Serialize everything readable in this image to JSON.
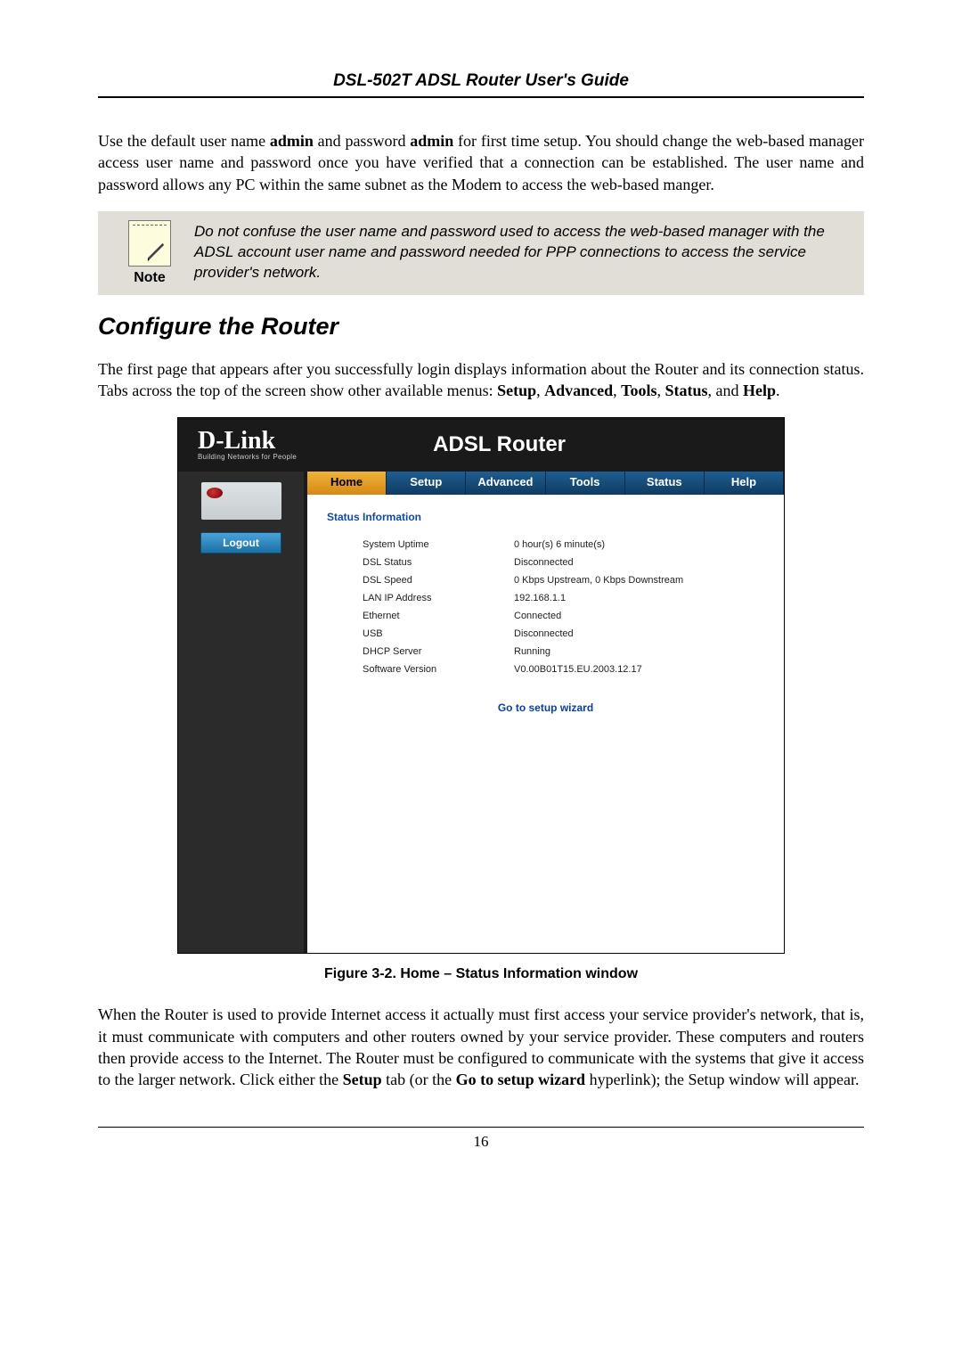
{
  "header": {
    "title": "DSL-502T ADSL Router User's Guide"
  },
  "intro_html": "Use the default user name <b>admin</b> and password <b>admin</b> for first time setup. You should change the web-based manager access user name and password once you have verified that a connection can be established. The user name and password allows any PC within the same subnet as the Modem to access the web-based manger.",
  "note": {
    "label": "Note",
    "text": "Do not confuse the user name and password used to access the web-based manager with the ADSL account user name and password needed for PPP connections to access the service provider's network."
  },
  "section_title": "Configure the Router",
  "section_intro_html": "The first page that appears after you successfully login displays information about the Router and its connection status. Tabs across the top of the screen show other available menus: <b>Setup</b>, <b>Advanced</b>, <b>Tools</b>, <b>Status</b>, and <b>Help</b>.",
  "figure": {
    "logo": "D-Link",
    "logo_sub": "Building Networks for People",
    "product": "ADSL Router",
    "logout": "Logout",
    "tabs": [
      "Home",
      "Setup",
      "Advanced",
      "Tools",
      "Status",
      "Help"
    ],
    "active_tab": 0,
    "section_label": "Status Information",
    "rows": [
      {
        "label": "System Uptime",
        "value": "0 hour(s) 6 minute(s)"
      },
      {
        "label": "DSL Status",
        "value": "Disconnected"
      },
      {
        "label": "DSL Speed",
        "value": "0 Kbps Upstream, 0 Kbps Downstream"
      },
      {
        "label": "LAN IP Address",
        "value": "192.168.1.1"
      },
      {
        "label": "Ethernet",
        "value": "Connected"
      },
      {
        "label": "USB",
        "value": "Disconnected"
      },
      {
        "label": "DHCP Server",
        "value": "Running"
      },
      {
        "label": "Software Version",
        "value": "V0.00B01T15.EU.2003.12.17"
      }
    ],
    "wizard_link": "Go to setup wizard"
  },
  "caption": "Figure 3-2. Home – Status Information window",
  "outro_html": "When the Router is used to provide Internet access it actually must first access your service provider's network, that is, it must communicate with computers and other routers owned by your service provider. These computers and routers then provide access to the Internet. The Router must be configured to communicate with the systems that give it access to the larger network. Click either the <b>Setup</b> tab (or the <b>Go to setup wizard</b> hyperlink); the Setup window will appear.",
  "page_number": "16"
}
